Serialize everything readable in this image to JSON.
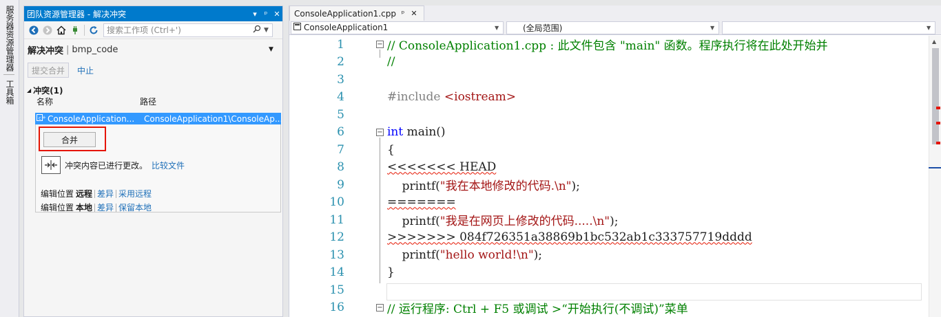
{
  "sidebar": {
    "tab1": "服务器资源管理器",
    "tab2": "工具箱"
  },
  "team_explorer": {
    "title": "团队资源管理器 - 解决冲突",
    "title_buttons": [
      "▾",
      "ᵖ",
      "✕"
    ],
    "search_placeholder": "搜索工作项 (Ctrl+')",
    "header": {
      "title": "解决冲突",
      "repo": "bmp_code"
    },
    "actions": {
      "commit_merge": "提交合并",
      "abort": "中止"
    },
    "conflicts": {
      "section": "冲突(1)",
      "col_name": "名称",
      "col_path": "路径",
      "rows": [
        {
          "name": "ConsoleApplication...",
          "path": "ConsoleApplication1\\ConsoleAp..."
        }
      ]
    },
    "detail": {
      "merge_button": "合并",
      "status": "冲突内容已进行更改。",
      "compare_link": "比较文件",
      "remote": {
        "label": "编辑位置",
        "where": "远程",
        "diff": "差异",
        "take": "采用远程"
      },
      "local": {
        "label": "编辑位置",
        "where": "本地",
        "diff": "差异",
        "keep": "保留本地"
      }
    }
  },
  "editor": {
    "tab": {
      "name": "ConsoleApplication1.cpp",
      "pin": "ᵖ",
      "close": "✕"
    },
    "nav": {
      "project": "ConsoleApplication1",
      "scope": "(全局范围)",
      "member": ""
    },
    "lines": [
      {
        "n": "1",
        "text": "// ConsoleApplication1.cpp : 此文件包含 \"main\" 函数。程序执行将在此处开始并"
      },
      {
        "n": "2",
        "text": "//"
      },
      {
        "n": "3",
        "text": ""
      },
      {
        "n": "4",
        "pre": "#include ",
        "text": "<iostream>"
      },
      {
        "n": "5",
        "text": ""
      },
      {
        "n": "6",
        "kw": "int",
        "text": " main()"
      },
      {
        "n": "7",
        "text": "{"
      },
      {
        "n": "8",
        "text": "<<<<<<< HEAD"
      },
      {
        "n": "9",
        "pre": "    printf(",
        "str": "\"我在本地修改的代码.\\n\"",
        "post": ");"
      },
      {
        "n": "10",
        "text": "======="
      },
      {
        "n": "11",
        "pre": "    printf(",
        "str": "\"我是在网页上修改的代码.....\\n\"",
        "post": ");"
      },
      {
        "n": "12",
        "text": ">>>>>>> 084f726351a38869b1bc532ab1c333757719dddd"
      },
      {
        "n": "13",
        "pre": "    printf(",
        "str": "\"hello world!\\n\"",
        "post": ");"
      },
      {
        "n": "14",
        "text": "}"
      },
      {
        "n": "15",
        "text": ""
      },
      {
        "n": "16",
        "text": "// 运行程序: Ctrl + F5 或调试 >“开始执行(不调试)”菜单"
      }
    ]
  },
  "colors": {
    "accent": "#007acc",
    "comment": "#008000",
    "keyword": "#0000ff",
    "string": "#a31515",
    "line_number": "#2b91af",
    "highlight_box": "#e51400",
    "selection": "#3399ff"
  }
}
